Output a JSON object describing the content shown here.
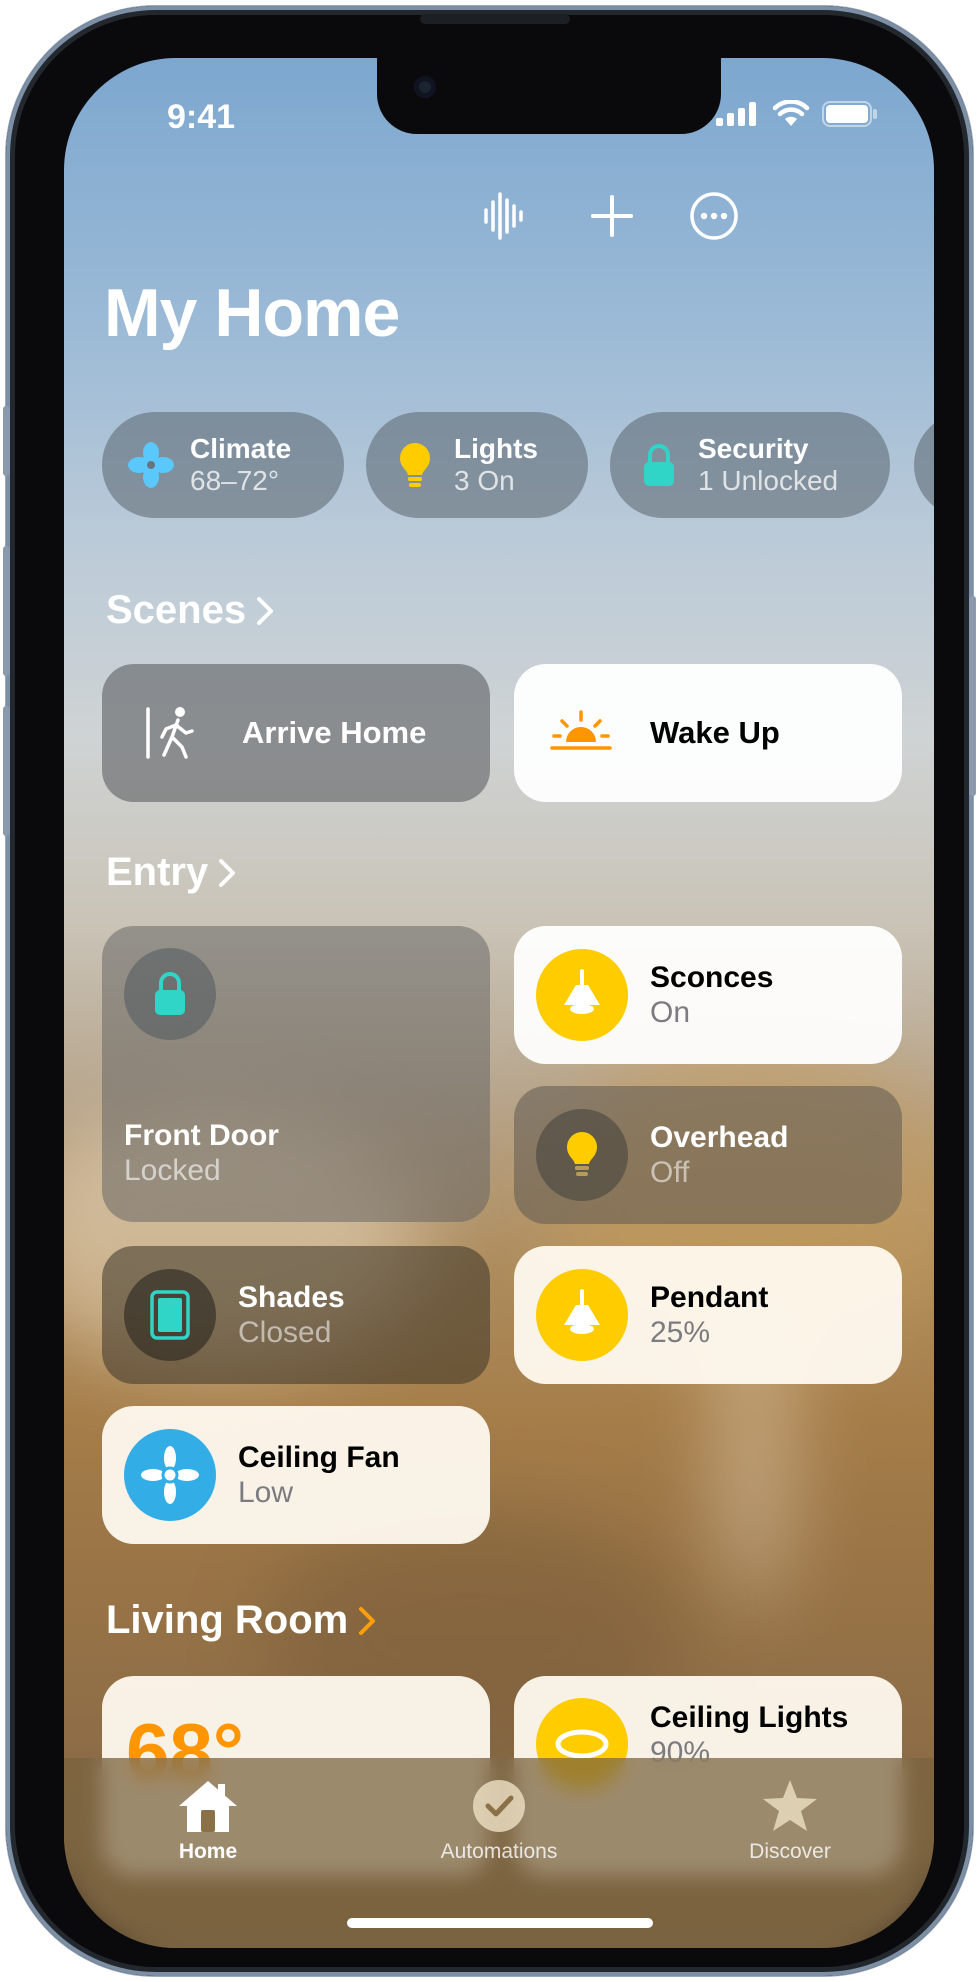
{
  "status_bar": {
    "time": "9:41"
  },
  "toolbar": {
    "icons": [
      "voice-waveform-icon",
      "plus-icon",
      "more-ellipsis-icon"
    ]
  },
  "page": {
    "title": "My Home"
  },
  "chips": [
    {
      "label": "Climate",
      "value": "68–72°",
      "icon": "fan-icon"
    },
    {
      "label": "Lights",
      "value": "3 On",
      "icon": "lightbulb-icon"
    },
    {
      "label": "Security",
      "value": "1 Unlocked",
      "icon": "lock-icon"
    }
  ],
  "sections": {
    "scenes": "Scenes",
    "entry": "Entry",
    "living_room": "Living Room"
  },
  "scenes": [
    {
      "name": "Arrive Home",
      "icon": "arrive-home-icon",
      "active": false
    },
    {
      "name": "Wake Up",
      "icon": "sunrise-icon",
      "active": true
    }
  ],
  "entry": {
    "front_door": {
      "name": "Front Door",
      "status": "Locked"
    },
    "sconces": {
      "name": "Sconces",
      "status": "On"
    },
    "overhead": {
      "name": "Overhead",
      "status": "Off"
    },
    "shades": {
      "name": "Shades",
      "status": "Closed"
    },
    "pendant": {
      "name": "Pendant",
      "status": "25%"
    },
    "ceiling_fan": {
      "name": "Ceiling Fan",
      "status": "Low"
    }
  },
  "living_room": {
    "thermostat": {
      "temperature": "68°"
    },
    "ceiling_lights": {
      "name": "Ceiling Lights",
      "status": "90%"
    }
  },
  "tabs": [
    {
      "label": "Home",
      "active": true
    },
    {
      "label": "Automations",
      "active": false
    },
    {
      "label": "Discover",
      "active": false
    }
  ],
  "colors": {
    "accent_yellow": "#ffcc00",
    "accent_teal": "#30d5c8",
    "accent_blue": "#32ade6",
    "scene_orange": "#ff9500"
  }
}
